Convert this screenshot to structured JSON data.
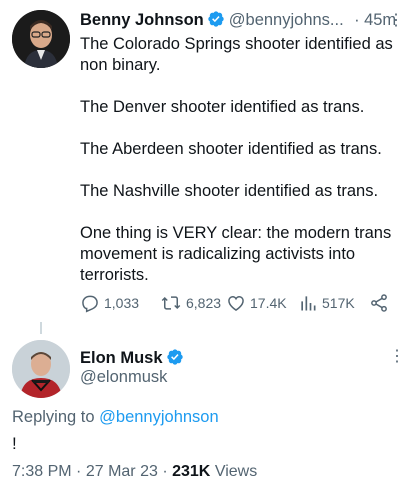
{
  "tweet": {
    "author_name": "Benny Johnson",
    "author_handle": "@bennyjohns...",
    "separator": "·",
    "time": "45m",
    "paragraphs": [
      "The Colorado Springs shooter identified as non binary.",
      "The Denver shooter identified as trans.",
      "The Aberdeen shooter identified as trans.",
      "The Nashville shooter identified as trans.",
      "One thing is VERY clear: the modern trans movement is radicalizing activists into terrorists."
    ],
    "stats": {
      "replies": "1,033",
      "retweets": "6,823",
      "likes": "17.4K",
      "views": "517K"
    }
  },
  "reply_tweet": {
    "author_name": "Elon Musk",
    "author_handle": "@elonmusk",
    "replying_prefix": "Replying to",
    "replying_to": "@bennyjohnson",
    "text": "!",
    "time": "7:38 PM",
    "date": "27 Mar 23",
    "meta_sep": "·",
    "views_count": "231K",
    "views_label": "Views"
  },
  "colors": {
    "verified": "#1d9bf0",
    "muted": "#536471",
    "link": "#1d9bf0"
  },
  "icons": [
    "verified-badge-icon",
    "more-icon",
    "reply-icon",
    "retweet-icon",
    "like-icon",
    "views-icon",
    "share-icon"
  ]
}
